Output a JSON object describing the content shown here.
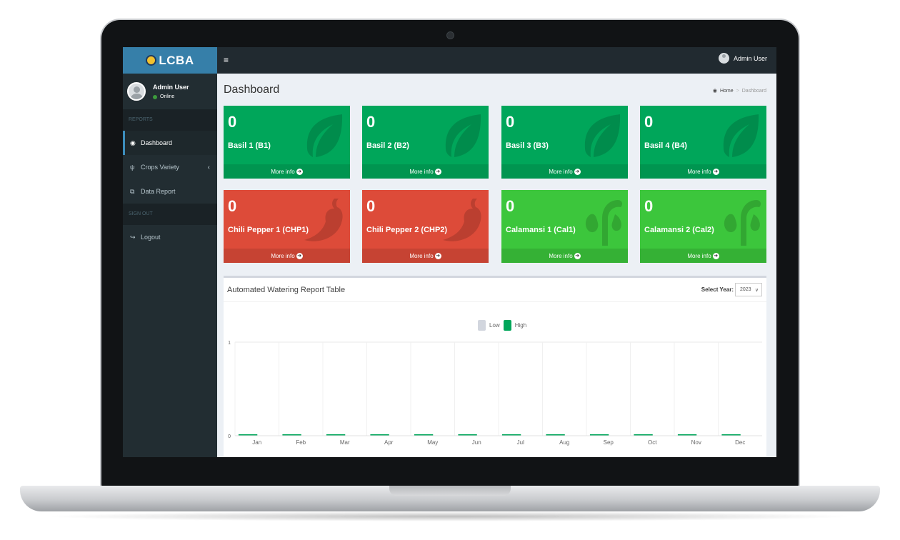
{
  "app": {
    "logo_text": "LCBA",
    "top_user": "Admin User"
  },
  "sidebar": {
    "user_name": "Admin User",
    "user_status": "Online",
    "section_reports": "REPORTS",
    "section_signout": "SIGN OUT",
    "items": [
      {
        "label": "Dashboard",
        "icon": "dashboard-icon"
      },
      {
        "label": "Crops Variety",
        "icon": "seedling-icon"
      },
      {
        "label": "Data Report",
        "icon": "copy-icon"
      },
      {
        "label": "Logout",
        "icon": "sign-out-icon"
      }
    ]
  },
  "header": {
    "title": "Dashboard",
    "breadcrumb_home": "Home",
    "breadcrumb_current": "Dashboard"
  },
  "cards": [
    {
      "value": "0",
      "label": "Basil 1 (B1)",
      "link": "More info",
      "color": "#00a65a",
      "icon": "leaf-icon"
    },
    {
      "value": "0",
      "label": "Basil 2 (B2)",
      "link": "More info",
      "color": "#00a65a",
      "icon": "leaf-icon"
    },
    {
      "value": "0",
      "label": "Basil 3 (B3)",
      "link": "More info",
      "color": "#00a65a",
      "icon": "leaf-icon"
    },
    {
      "value": "0",
      "label": "Basil 4 (B4)",
      "link": "More info",
      "color": "#00a65a",
      "icon": "leaf-icon"
    },
    {
      "value": "0",
      "label": "Chili Pepper 1 (CHP1)",
      "link": "More info",
      "color": "#dd4b39",
      "icon": "pepper-icon"
    },
    {
      "value": "0",
      "label": "Chili Pepper 2 (CHP2)",
      "link": "More info",
      "color": "#dd4b39",
      "icon": "pepper-icon"
    },
    {
      "value": "0",
      "label": "Calamansi 1 (Cal1)",
      "link": "More info",
      "color": "#3cc63c",
      "icon": "seedling-icon"
    },
    {
      "value": "0",
      "label": "Calamansi 2 (Cal2)",
      "link": "More info",
      "color": "#3cc63c",
      "icon": "seedling-icon"
    }
  ],
  "report": {
    "title": "Automated Watering Report Table",
    "year_label": "Select Year:",
    "year_value": "2023"
  },
  "chart_data": {
    "type": "bar",
    "categories": [
      "Jan",
      "Feb",
      "Mar",
      "Apr",
      "May",
      "Jun",
      "Jul",
      "Aug",
      "Sep",
      "Oct",
      "Nov",
      "Dec"
    ],
    "series": [
      {
        "name": "Low",
        "values": [
          0,
          0,
          0,
          0,
          0,
          0,
          0,
          0,
          0,
          0,
          0,
          0
        ],
        "color": "#d2d6de"
      },
      {
        "name": "High",
        "values": [
          0,
          0,
          0,
          0,
          0,
          0,
          0,
          0,
          0,
          0,
          0,
          0
        ],
        "color": "#00a65a"
      }
    ],
    "yticks": [
      "0",
      "1"
    ],
    "ylim": [
      0,
      1
    ],
    "legend": "top-center",
    "grid": true
  }
}
